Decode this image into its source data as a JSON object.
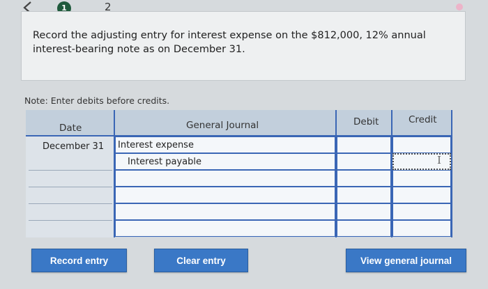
{
  "nav": {
    "step_one": "1",
    "step_two": "2"
  },
  "question": {
    "text": "Record the adjusting entry for interest expense on the $812,000, 12% annual interest-bearing note as on December 31."
  },
  "note": "Note: Enter debits before credits.",
  "journal": {
    "headers": {
      "date": "Date",
      "account": "General Journal",
      "debit": "Debit",
      "credit": "Credit"
    },
    "date_value": "December 31",
    "rows": [
      {
        "account": "Interest expense",
        "debit": "",
        "credit": ""
      },
      {
        "account": "Interest payable",
        "debit": "",
        "credit": ""
      },
      {
        "account": "",
        "debit": "",
        "credit": ""
      },
      {
        "account": "",
        "debit": "",
        "credit": ""
      },
      {
        "account": "",
        "debit": "",
        "credit": ""
      },
      {
        "account": "",
        "debit": "",
        "credit": ""
      }
    ]
  },
  "buttons": {
    "record": "Record entry",
    "clear": "Clear entry",
    "view": "View general journal"
  },
  "colors": {
    "accent": "#3a78c6",
    "table_border": "#3a66b5",
    "badge": "#1f5a3c"
  }
}
